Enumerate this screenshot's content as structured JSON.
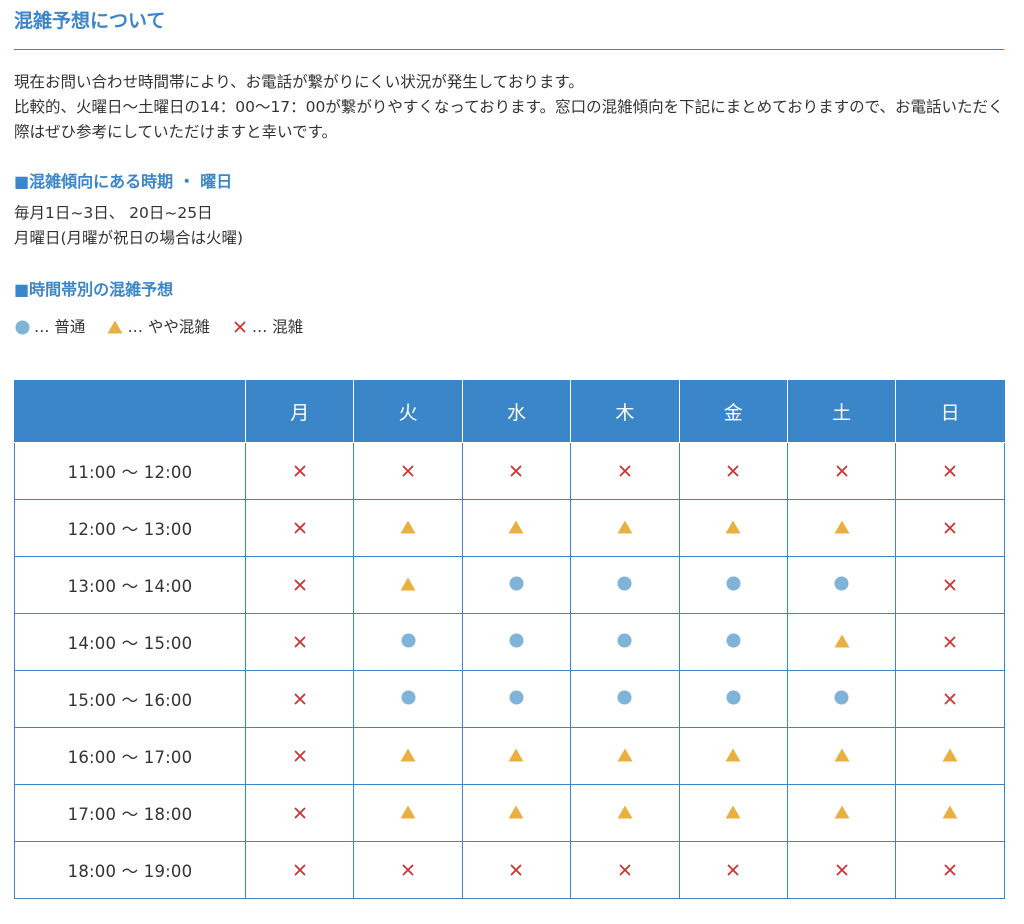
{
  "title": "混雑予想について",
  "intro": [
    "現在お問い合わせ時間帯により、お電話が繋がりにくい状況が発生しております。",
    "比較的、火曜日〜土曜日の14：00〜17：00が繋がりやすくなっております。窓口の混雑傾向を下記にまとめておりますので、お電話いただく際はぜひ参考にしていただけますと幸いです。"
  ],
  "section1": {
    "heading": "■混雑傾向にある時期 ・ 曜日",
    "lines": [
      "毎月1日~3日、 20日~25日",
      "月曜日(月曜が祝日の場合は火曜)"
    ]
  },
  "section2": {
    "heading": "■時間帯別の混雑予想"
  },
  "legend": [
    {
      "mark": "circle",
      "label": "… 普通"
    },
    {
      "mark": "triangle",
      "label": "… やや混雑"
    },
    {
      "mark": "cross",
      "label": "… 混雑"
    }
  ],
  "colors": {
    "accent": "#3a86c8",
    "circle": "#7fb3d8",
    "triangle": "#e8b040",
    "cross": "#cc3333"
  },
  "icons": {
    "circle": "circle-icon",
    "triangle": "triangle-icon",
    "cross": "cross-icon"
  },
  "table": {
    "corner": "",
    "days": [
      "月",
      "火",
      "水",
      "木",
      "金",
      "土",
      "日"
    ],
    "rows": [
      {
        "time": "11:00 〜 12:00",
        "marks": [
          "cross",
          "cross",
          "cross",
          "cross",
          "cross",
          "cross",
          "cross"
        ]
      },
      {
        "time": "12:00 〜 13:00",
        "marks": [
          "cross",
          "triangle",
          "triangle",
          "triangle",
          "triangle",
          "triangle",
          "cross"
        ]
      },
      {
        "time": "13:00 〜 14:00",
        "marks": [
          "cross",
          "triangle",
          "circle",
          "circle",
          "circle",
          "circle",
          "cross"
        ]
      },
      {
        "time": "14:00 〜 15:00",
        "marks": [
          "cross",
          "circle",
          "circle",
          "circle",
          "circle",
          "triangle",
          "cross"
        ]
      },
      {
        "time": "15:00 〜 16:00",
        "marks": [
          "cross",
          "circle",
          "circle",
          "circle",
          "circle",
          "circle",
          "cross"
        ]
      },
      {
        "time": "16:00 〜 17:00",
        "marks": [
          "cross",
          "triangle",
          "triangle",
          "triangle",
          "triangle",
          "triangle",
          "triangle"
        ]
      },
      {
        "time": "17:00 〜 18:00",
        "marks": [
          "cross",
          "triangle",
          "triangle",
          "triangle",
          "triangle",
          "triangle",
          "triangle"
        ]
      },
      {
        "time": "18:00 〜 19:00",
        "marks": [
          "cross",
          "cross",
          "cross",
          "cross",
          "cross",
          "cross",
          "cross"
        ]
      }
    ]
  }
}
